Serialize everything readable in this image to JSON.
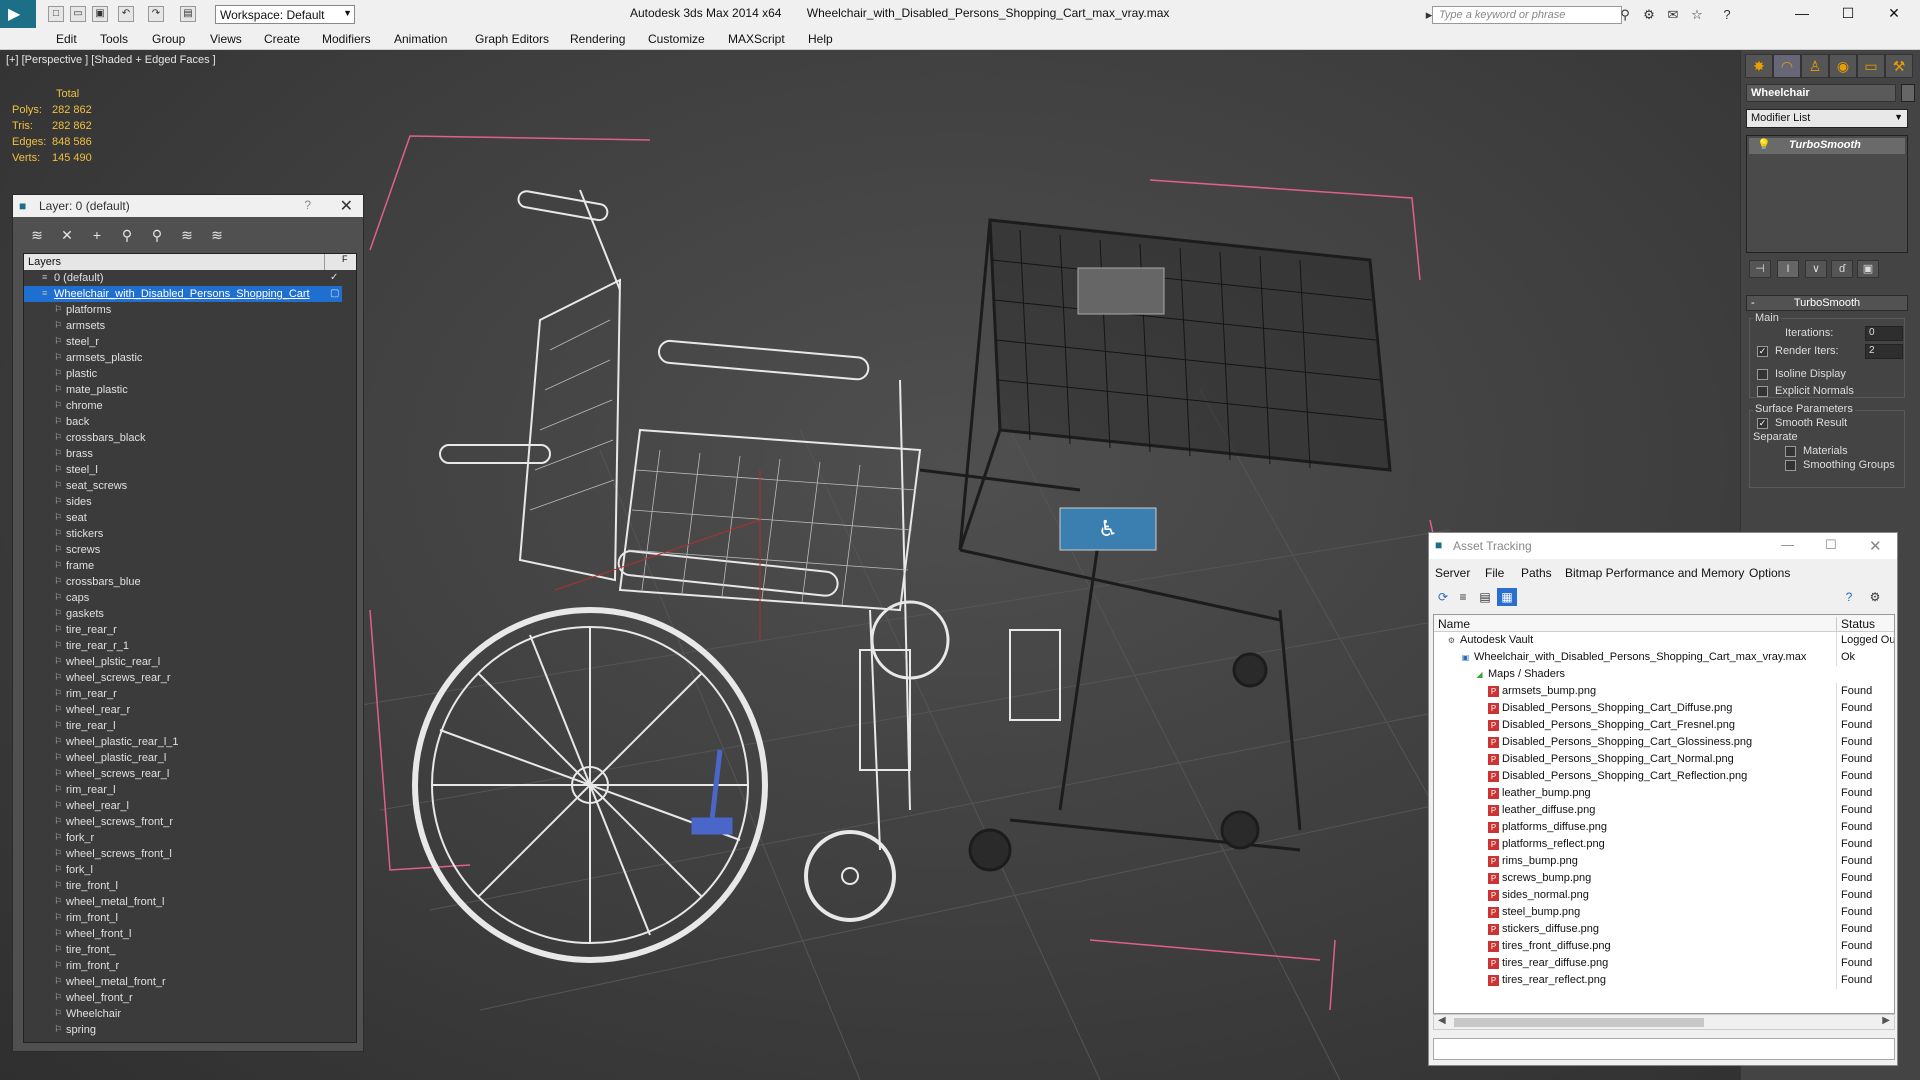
{
  "titlebar": {
    "workspace": "Workspace: Default",
    "app_title": "Autodesk 3ds Max  2014 x64",
    "file_title": "Wheelchair_with_Disabled_Persons_Shopping_Cart_max_vray.max",
    "search_placeholder": "Type a keyword or phrase"
  },
  "menu": [
    "Edit",
    "Tools",
    "Group",
    "Views",
    "Create",
    "Modifiers",
    "Animation",
    "Graph Editors",
    "Rendering",
    "Customize",
    "MAXScript",
    "Help"
  ],
  "viewport": {
    "label": "[+] [Perspective ] [Shaded + Edged Faces ]",
    "stats_header": "Total",
    "stats": [
      {
        "label": "Polys:",
        "value": "282 862"
      },
      {
        "label": "Tris:",
        "value": "282 862"
      },
      {
        "label": "Edges:",
        "value": "848 586"
      },
      {
        "label": "Verts:",
        "value": "145 490"
      }
    ]
  },
  "command_panel": {
    "object_name": "Wheelchair",
    "modifier_list": "Modifier List",
    "stack_item": "TurboSmooth",
    "rollout_title": "TurboSmooth",
    "main_group": "Main",
    "iterations_label": "Iterations:",
    "iterations_value": "0",
    "render_iters_label": "Render Iters:",
    "render_iters_value": "2",
    "isoline_label": "Isoline Display",
    "explicit_normals_label": "Explicit Normals",
    "surface_params_label": "Surface Parameters",
    "smooth_result_label": "Smooth Result",
    "separate_label": "Separate",
    "materials_label": "Materials",
    "smoothing_groups_label": "Smoothing Groups"
  },
  "layer_panel": {
    "title": "Layer: 0 (default)",
    "help": "?",
    "column_header": "Layers",
    "layers": [
      {
        "name": "0 (default)",
        "level": 0
      },
      {
        "name": "Wheelchair_with_Disabled_Persons_Shopping_Cart",
        "level": 0,
        "selected": true
      },
      {
        "name": "platforms",
        "level": 1
      },
      {
        "name": "armsets",
        "level": 1
      },
      {
        "name": "steel_r",
        "level": 1
      },
      {
        "name": "armsets_plastic",
        "level": 1
      },
      {
        "name": "plastic",
        "level": 1
      },
      {
        "name": "mate_plastic",
        "level": 1
      },
      {
        "name": "chrome",
        "level": 1
      },
      {
        "name": "back",
        "level": 1
      },
      {
        "name": "crossbars_black",
        "level": 1
      },
      {
        "name": "brass",
        "level": 1
      },
      {
        "name": "steel_l",
        "level": 1
      },
      {
        "name": "seat_screws",
        "level": 1
      },
      {
        "name": "sides",
        "level": 1
      },
      {
        "name": "seat",
        "level": 1
      },
      {
        "name": "stickers",
        "level": 1
      },
      {
        "name": "screws",
        "level": 1
      },
      {
        "name": "frame",
        "level": 1
      },
      {
        "name": "crossbars_blue",
        "level": 1
      },
      {
        "name": "caps",
        "level": 1
      },
      {
        "name": "gaskets",
        "level": 1
      },
      {
        "name": "tire_rear_r",
        "level": 1
      },
      {
        "name": "tire_rear_r_1",
        "level": 1
      },
      {
        "name": "wheel_plstic_rear_l",
        "level": 1
      },
      {
        "name": "wheel_screws_rear_r",
        "level": 1
      },
      {
        "name": "rim_rear_r",
        "level": 1
      },
      {
        "name": "wheel_rear_r",
        "level": 1
      },
      {
        "name": "tire_rear_l",
        "level": 1
      },
      {
        "name": "wheel_plastic_rear_l_1",
        "level": 1
      },
      {
        "name": "wheel_plastic_rear_l",
        "level": 1
      },
      {
        "name": "wheel_screws_rear_l",
        "level": 1
      },
      {
        "name": "rim_rear_l",
        "level": 1
      },
      {
        "name": "wheel_rear_l",
        "level": 1
      },
      {
        "name": "wheel_screws_front_r",
        "level": 1
      },
      {
        "name": "fork_r",
        "level": 1
      },
      {
        "name": "wheel_screws_front_l",
        "level": 1
      },
      {
        "name": "fork_l",
        "level": 1
      },
      {
        "name": "tire_front_l",
        "level": 1
      },
      {
        "name": "wheel_metal_front_l",
        "level": 1
      },
      {
        "name": "rim_front_l",
        "level": 1
      },
      {
        "name": "wheel_front_l",
        "level": 1
      },
      {
        "name": "tire_front_",
        "level": 1
      },
      {
        "name": "rim_front_r",
        "level": 1
      },
      {
        "name": "wheel_metal_front_r",
        "level": 1
      },
      {
        "name": "wheel_front_r",
        "level": 1
      },
      {
        "name": "Wheelchair",
        "level": 1
      },
      {
        "name": "spring",
        "level": 1
      }
    ]
  },
  "asset_tracking": {
    "title": "Asset Tracking",
    "menu": [
      "Server",
      "File",
      "Paths",
      "Bitmap Performance and Memory",
      "Options"
    ],
    "col_name": "Name",
    "col_status": "Status",
    "rows": [
      {
        "name": "Autodesk Vault",
        "status": "Logged Out",
        "level": 0,
        "icon": "vault"
      },
      {
        "name": "Wheelchair_with_Disabled_Persons_Shopping_Cart_max_vray.max",
        "status": "Ok",
        "level": 1,
        "icon": "max"
      },
      {
        "name": "Maps / Shaders",
        "status": "",
        "level": 2,
        "icon": "maps"
      },
      {
        "name": "armsets_bump.png",
        "status": "Found",
        "level": 3,
        "icon": "png"
      },
      {
        "name": "Disabled_Persons_Shopping_Cart_Diffuse.png",
        "status": "Found",
        "level": 3,
        "icon": "png"
      },
      {
        "name": "Disabled_Persons_Shopping_Cart_Fresnel.png",
        "status": "Found",
        "level": 3,
        "icon": "png"
      },
      {
        "name": "Disabled_Persons_Shopping_Cart_Glossiness.png",
        "status": "Found",
        "level": 3,
        "icon": "png"
      },
      {
        "name": "Disabled_Persons_Shopping_Cart_Normal.png",
        "status": "Found",
        "level": 3,
        "icon": "png"
      },
      {
        "name": "Disabled_Persons_Shopping_Cart_Reflection.png",
        "status": "Found",
        "level": 3,
        "icon": "png"
      },
      {
        "name": "leather_bump.png",
        "status": "Found",
        "level": 3,
        "icon": "png"
      },
      {
        "name": "leather_diffuse.png",
        "status": "Found",
        "level": 3,
        "icon": "png"
      },
      {
        "name": "platforms_diffuse.png",
        "status": "Found",
        "level": 3,
        "icon": "png"
      },
      {
        "name": "platforms_reflect.png",
        "status": "Found",
        "level": 3,
        "icon": "png"
      },
      {
        "name": "rims_bump.png",
        "status": "Found",
        "level": 3,
        "icon": "png"
      },
      {
        "name": "screws_bump.png",
        "status": "Found",
        "level": 3,
        "icon": "png"
      },
      {
        "name": "sides_normal.png",
        "status": "Found",
        "level": 3,
        "icon": "png"
      },
      {
        "name": "steel_bump.png",
        "status": "Found",
        "level": 3,
        "icon": "png"
      },
      {
        "name": "stickers_diffuse.png",
        "status": "Found",
        "level": 3,
        "icon": "png"
      },
      {
        "name": "tires_front_diffuse.png",
        "status": "Found",
        "level": 3,
        "icon": "png"
      },
      {
        "name": "tires_rear_diffuse.png",
        "status": "Found",
        "level": 3,
        "icon": "png"
      },
      {
        "name": "tires_rear_reflect.png",
        "status": "Found",
        "level": 3,
        "icon": "png"
      }
    ]
  },
  "colors": {
    "stats_text": "#f0c040",
    "selection": "#1f6fd1",
    "bbox_corner": "#e0608a",
    "viewport_bg": "#3e3e3e"
  }
}
